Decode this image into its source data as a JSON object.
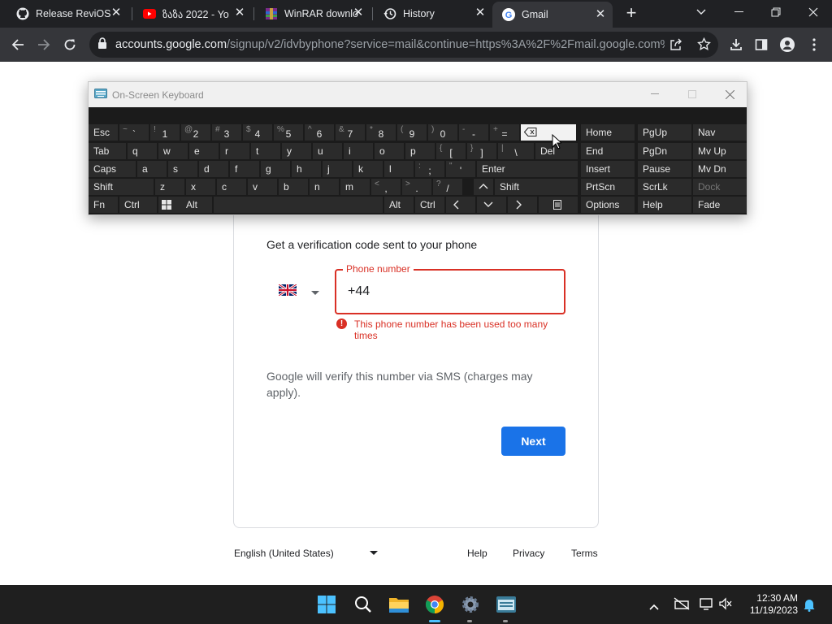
{
  "browser": {
    "tabs": [
      {
        "label": "Release ReviOS",
        "icon": "github-icon"
      },
      {
        "label": "ზაზა 2022 - Yo",
        "icon": "youtube-icon"
      },
      {
        "label": "WinRAR downlo",
        "icon": "winrar-icon"
      },
      {
        "label": "History",
        "icon": "history-icon"
      },
      {
        "label": "Gmail",
        "icon": "google-icon",
        "active": true
      }
    ],
    "url_host": "accounts.google.com",
    "url_path": "/signup/v2/idvbyphone?service=mail&continue=https%3A%2F%2Fmail.google.com%..."
  },
  "signup": {
    "verify_text": "Get a verification code sent to your phone",
    "phone_label": "Phone number",
    "phone_value": "+44",
    "error_text": "This phone number has been used too many times",
    "sms_text": "Google will verify this number via SMS (charges may apply).",
    "next_label": "Next",
    "error_color": "#d93025",
    "accent": "#1a73e8"
  },
  "footer": {
    "language": "English (United States)",
    "help": "Help",
    "privacy": "Privacy",
    "terms": "Terms"
  },
  "osk": {
    "title": "On-Screen Keyboard",
    "row1": [
      "Esc",
      "~ `",
      "! 1",
      "@ 2",
      "# 3",
      "$ 4",
      "% 5",
      "^ 6",
      "& 7",
      "* 8",
      "( 9",
      ") 0",
      "- -",
      "+ ="
    ],
    "row2": [
      "Tab",
      "q",
      "w",
      "e",
      "r",
      "t",
      "y",
      "u",
      "i",
      "o",
      "p",
      "{ [",
      "} ]",
      "| \\",
      "Del"
    ],
    "row3": [
      "Caps",
      "a",
      "s",
      "d",
      "f",
      "g",
      "h",
      "j",
      "k",
      "l",
      ": ;",
      "\" '",
      "Enter"
    ],
    "row4": [
      "Shift",
      "z",
      "x",
      "c",
      "v",
      "b",
      "n",
      "m",
      "< ,",
      "> .",
      "? /",
      "Shift"
    ],
    "row5": [
      "Fn",
      "Ctrl",
      "Alt",
      "Alt",
      "Ctrl"
    ],
    "right": [
      [
        "Home",
        "PgUp",
        "Nav"
      ],
      [
        "End",
        "PgDn",
        "Mv Up"
      ],
      [
        "Insert",
        "Pause",
        "Mv Dn"
      ],
      [
        "PrtScn",
        "ScrLk",
        "Dock"
      ],
      [
        "Options",
        "Help",
        "Fade"
      ]
    ]
  },
  "taskbar": {
    "time": "12:30 AM",
    "date": "11/19/2023"
  }
}
